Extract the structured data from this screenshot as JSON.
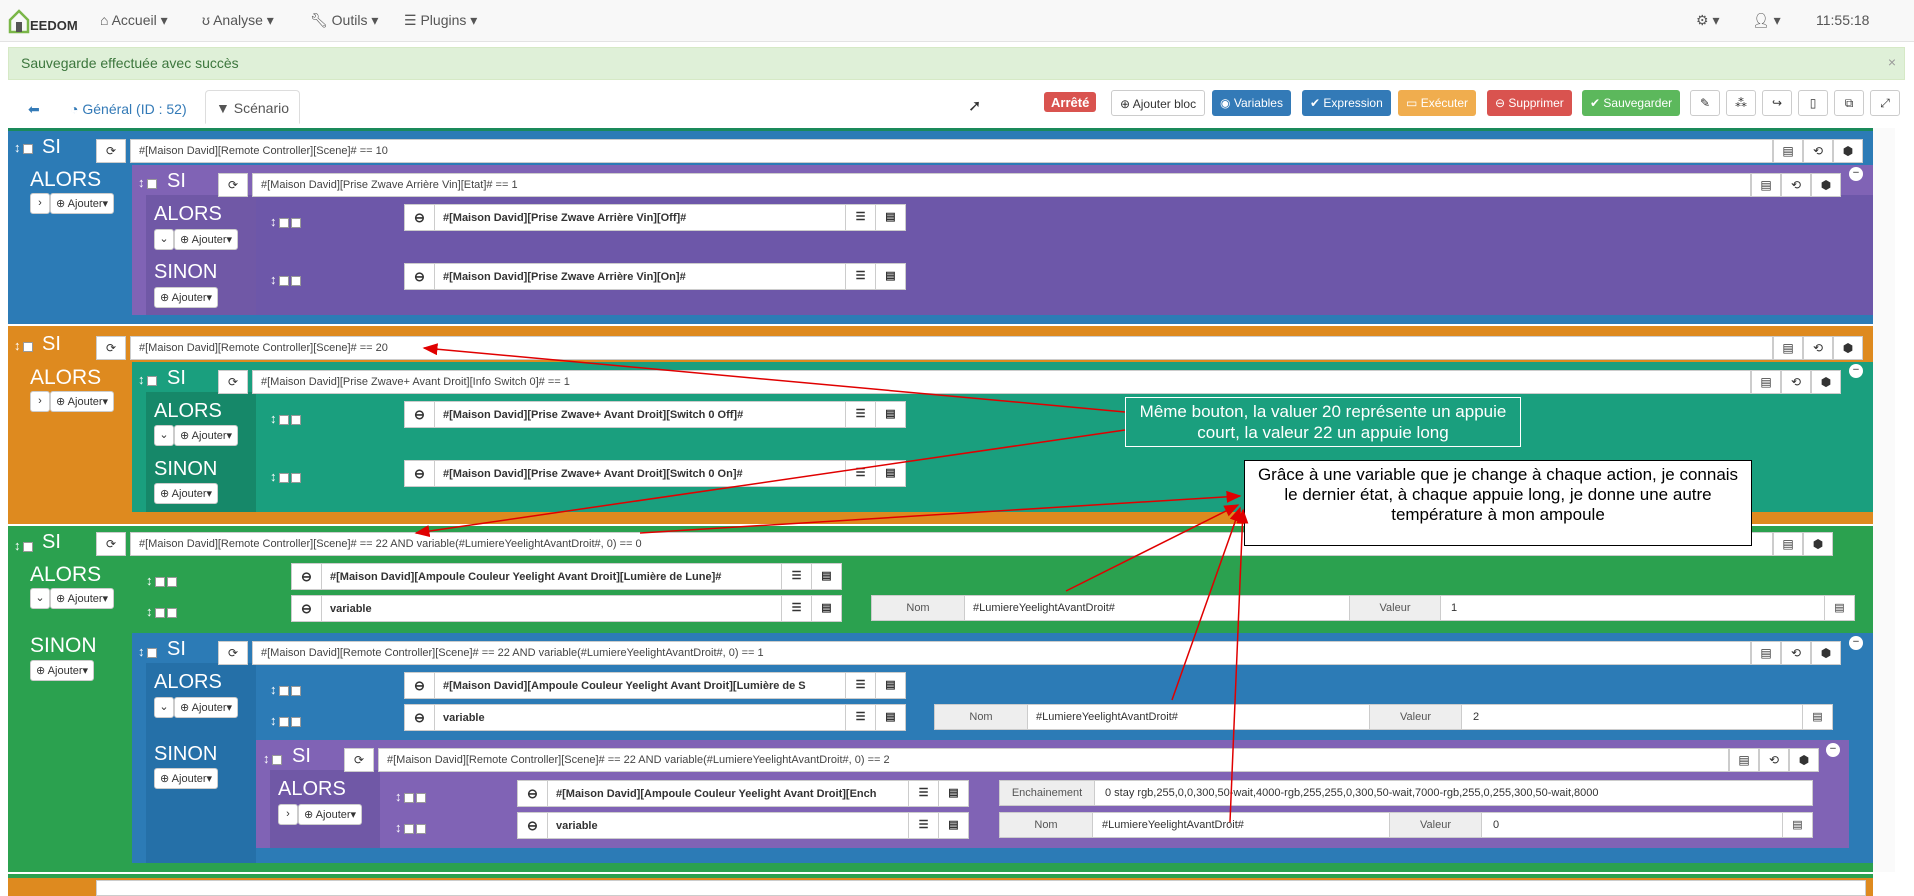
{
  "nav": {
    "logo": "EEDOM",
    "accueil": "Accueil",
    "analyse": "Analyse",
    "outils": "Outils",
    "plugins": "Plugins",
    "time": "11:55:18"
  },
  "alert": {
    "message": "Sauvegarde effectuée avec succès",
    "close": "×"
  },
  "tabs": {
    "general": "Général (ID : 52)",
    "scenario": "Scénario"
  },
  "toolbar": {
    "status": "Arrêté",
    "add_block": "Ajouter bloc",
    "variables": "Variables",
    "expression": "Expression",
    "execute": "Exécuter",
    "delete": "Supprimer",
    "save": "Sauvegarder"
  },
  "kw": {
    "si": "SI",
    "alors": "ALORS",
    "sinon": "SINON",
    "ajouter": "Ajouter"
  },
  "blocks": {
    "b1_cond": "#[Maison David][Remote Controller][Scene]# ==  10",
    "b1_inner_cond": "#[Maison David][Prise Zwave Arrière Vin][Etat]# == 1",
    "b1_act_off": "#[Maison David][Prise Zwave Arrière Vin][Off]#",
    "b1_act_on": "#[Maison David][Prise Zwave Arrière Vin][On]#",
    "b2_cond": "#[Maison David][Remote Controller][Scene]# ==  20",
    "b2_inner_cond": "#[Maison David][Prise Zwave+ Avant Droit][Info Switch 0]# == 1",
    "b2_act_off": "#[Maison David][Prise Zwave+ Avant Droit][Switch 0 Off]#",
    "b2_act_on": "#[Maison David][Prise Zwave+ Avant Droit][Switch 0 On]#",
    "b3_cond": "#[Maison David][Remote Controller][Scene]# ==  22  AND variable(#LumiereYeelightAvantDroit#, 0) == 0",
    "b3_act1": "#[Maison David][Ampoule Couleur Yeelight Avant Droit][Lumière de Lune]#",
    "b3_act2": "variable",
    "b3_nom_label": "Nom",
    "b3_nom": "#LumiereYeelightAvantDroit#",
    "b3_valeur_label": "Valeur",
    "b3_valeur": "1",
    "b4_cond": "#[Maison David][Remote Controller][Scene]# ==  22  AND variable(#LumiereYeelightAvantDroit#, 0)  == 1",
    "b4_act1": "#[Maison David][Ampoule Couleur Yeelight Avant Droit][Lumière de S",
    "b4_act2": "variable",
    "b4_nom_label": "Nom",
    "b4_nom": "#LumiereYeelightAvantDroit#",
    "b4_valeur_label": "Valeur",
    "b4_valeur": "2",
    "b5_cond": "#[Maison David][Remote Controller][Scene]# ==  22  AND variable(#LumiereYeelightAvantDroit#, 0)  == 2",
    "b5_act1": "#[Maison David][Ampoule Couleur Yeelight Avant Droit][Ench",
    "b5_act2": "variable",
    "b5_ench_label": "Enchainement",
    "b5_ench": "0 stay rgb,255,0,0,300,50-wait,4000-rgb,255,255,0,300,50-wait,7000-rgb,255,0,255,300,50-wait,8000",
    "b5_nom_label": "Nom",
    "b5_nom": "#LumiereYeelightAvantDroit#",
    "b5_valeur_label": "Valeur",
    "b5_valeur": "0"
  },
  "annotations": {
    "note1": "Même bouton, la valuer 20 représente un appuie court, la valeur 22 un appuie long",
    "note2": "Grâce à une variable que je change à chaque action, je connais le dernier état, à chaque appuie long, je donne une autre température à mon ampoule"
  },
  "colors": {
    "blue": "#2c7bb6",
    "purple": "#8063b5",
    "orange": "#de8a1f",
    "teal": "#1a9f7e",
    "green": "#2ba14f",
    "arrow": "#e00000"
  }
}
